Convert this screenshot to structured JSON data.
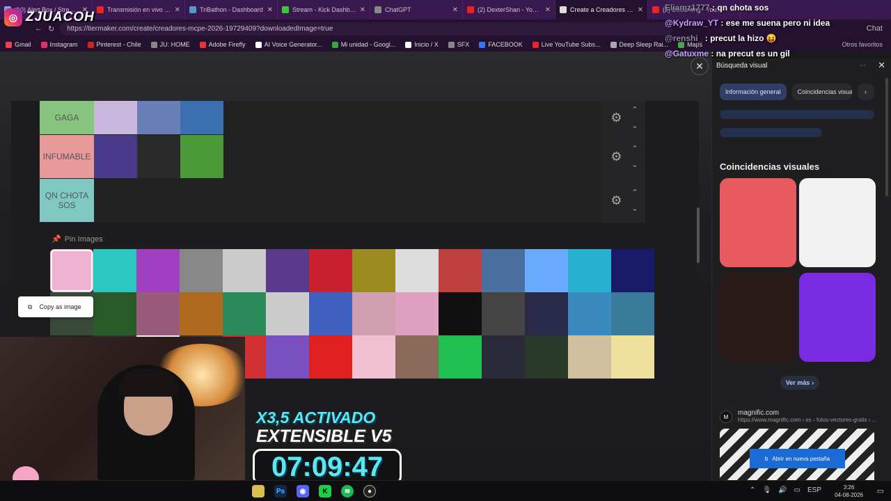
{
  "tabs": [
    {
      "label": "(10) Alert Box / Streamlabs",
      "color": "#7ad"
    },
    {
      "label": "Transmisión en vivo - YouTube",
      "color": "#e22"
    },
    {
      "label": "TriBathon - Dashboard",
      "color": "#59c"
    },
    {
      "label": "Stream - Kick Dashboard",
      "color": "#3c3"
    },
    {
      "label": "ChatGPT",
      "color": "#888"
    },
    {
      "label": "(2) DexterShan - YouTube",
      "color": "#e22"
    },
    {
      "label": "Create a Creadores MCPE",
      "color": "#ddd"
    },
    {
      "label": "(2) Debanting - YouTube",
      "color": "#e22"
    }
  ],
  "address": {
    "url": "https://tiermaker.com/create/creadores-mcpe-2026-19729409?downloadedImage=true"
  },
  "bookmarks": [
    {
      "label": "Gmail",
      "color": "#e44"
    },
    {
      "label": "Instagram",
      "color": "#d36"
    },
    {
      "label": "Pinterest - Chile",
      "color": "#c22"
    },
    {
      "label": "JU: HOME",
      "color": "#888"
    },
    {
      "label": "Adobe Firefly",
      "color": "#e33"
    },
    {
      "label": "AI Voice Generator...",
      "color": "#fff"
    },
    {
      "label": "Mi unidad - Googl...",
      "color": "#3a3"
    },
    {
      "label": "Inicio / X",
      "color": "#fff"
    },
    {
      "label": "SFX",
      "color": "#888"
    },
    {
      "label": "FACEBOOK",
      "color": "#37f"
    },
    {
      "label": "Live YouTube Subs...",
      "color": "#e22"
    },
    {
      "label": "Deep Sleep Rai...",
      "color": "#aaa"
    },
    {
      "label": "Maps",
      "color": "#4a4"
    }
  ],
  "bookmarks_other": "Otros favoritos",
  "stream": {
    "handle": "ZJUACOH",
    "chat": [
      {
        "user": "Eliamz1777",
        "msg": ": qn chota sos"
      },
      {
        "user": "@Kydraw_YT",
        "msg": ": ese me suena pero ni idea"
      },
      {
        "user": "@renshi_",
        "msg": ": precut la hizo 😝"
      },
      {
        "user": "@Gatuxme",
        "msg": ": na precut es un gil"
      }
    ],
    "banner1": "X3,5 ACTIVADO",
    "banner2": "EXTENSIBLE V5",
    "timer": "07:09:47"
  },
  "tiers": [
    {
      "label": "GAGA",
      "color": "#88c47e",
      "thumbs": [
        "#c9b6dd",
        "#6a7fb7",
        "#3a70b0"
      ]
    },
    {
      "label": "INFUMABLE",
      "color": "#e89a9a",
      "thumbs": [
        "#4a3a8a",
        "#2a2a2a",
        "#4a9a3a"
      ]
    },
    {
      "label": "QN CHOTA SOS",
      "color": "#7fc8c4",
      "thumbs": []
    }
  ],
  "pin_label": "Pin Images",
  "grid_colors": [
    "#f0b0d0",
    "#2cc7c0",
    "#a040c0",
    "#888",
    "#ccc",
    "#5a3a8a",
    "#c82030",
    "#9a8a20",
    "#dddddd",
    "#c04040",
    "#4a70a0",
    "#6aaaff",
    "#28b0d0",
    "#1a1a6a",
    "#3a4a3a",
    "#2a5a2a",
    "#9a5a7a",
    "#b06a20",
    "#2a8a5a",
    "#ccc",
    "#4060c0",
    "#d0a0b0",
    "#e0a0c0",
    "#111",
    "#444",
    "#2a2a4a",
    "#3a8ac0",
    "#3a7a9a",
    "#222",
    "#333",
    "#eee",
    "#3a3a3a",
    "#d03030",
    "#7a50c0",
    "#e02020",
    "#f0c0d0",
    "#8a6a5a",
    "#20c050",
    "#2a2a3a",
    "#2a3a2a",
    "#d0c0a0",
    "#f0e0a0"
  ],
  "copy_menu": "Copy as image",
  "panel": {
    "title": "Búsqueda visual",
    "chips": [
      "Información general",
      "Coincidencias visuales"
    ],
    "section": "Coincidencias visuales",
    "results": [
      {
        "color": "#e85a60"
      },
      {
        "color": "#f2f2f2"
      },
      {
        "color": "#2a1a1a"
      },
      {
        "color": "#7a2ae0"
      }
    ],
    "ver_mas": "Ver más",
    "source_name": "magnific.com",
    "source_url": "https://www.magnific.com › es › fotos-vectores-gratis › ...",
    "open_tab": "Abrir en nueva pestaña"
  },
  "taskbar": {
    "lang": "ESP",
    "time": "3:26",
    "date": "04-08-2026"
  }
}
